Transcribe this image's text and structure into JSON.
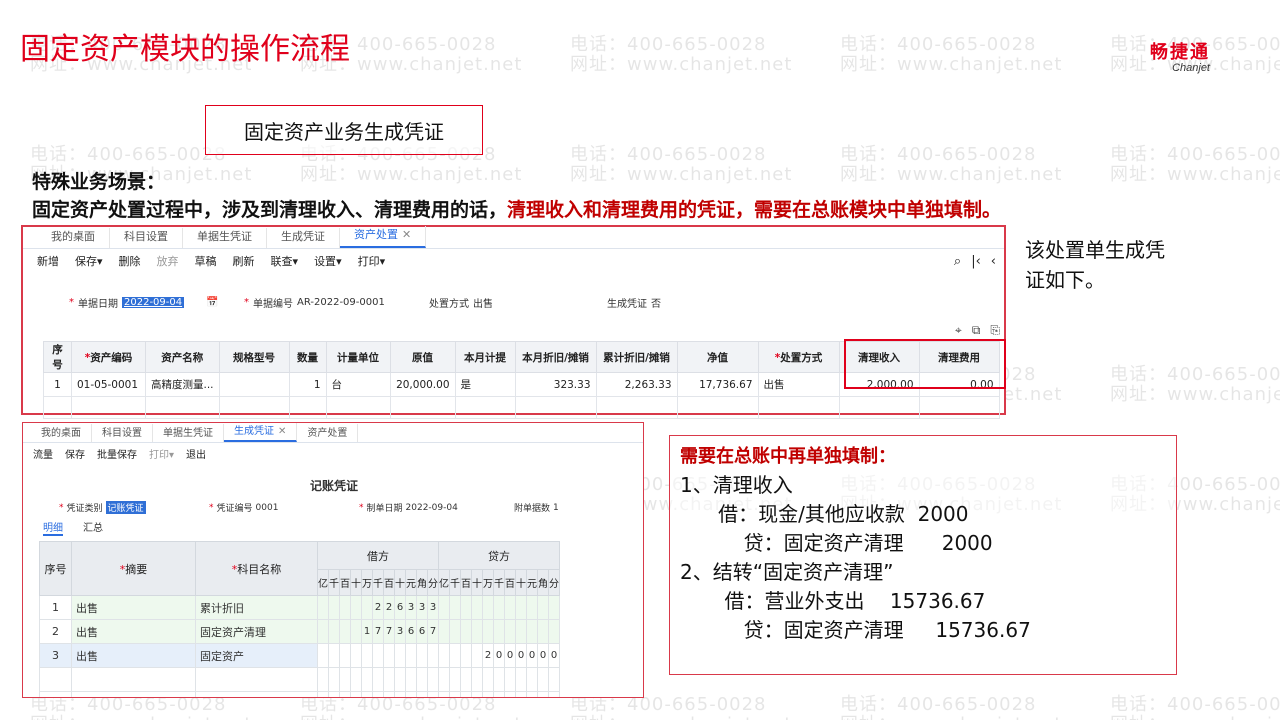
{
  "slide": {
    "title": "固定资产模块的操作流程",
    "subtitle": "固定资产业务生成凭证",
    "scenario_label": "特殊业务场景：",
    "scenario_text": "固定资产处置过程中，涉及到清理收入、清理费用的话，",
    "scenario_highlight": "清理收入和清理费用的凭证，需要在总账模块中单独填制。",
    "side_note": "该处置单生成凭证如下。",
    "logo_cn": "畅捷通",
    "logo_en": "Chanjet",
    "watermark_phone": "电话：400-665-0028",
    "watermark_web": "网址：www.chanjet.net"
  },
  "disposal_window": {
    "tabs": [
      {
        "label": "我的桌面"
      },
      {
        "label": "科目设置"
      },
      {
        "label": "单据生凭证"
      },
      {
        "label": "生成凭证"
      },
      {
        "label": "资产处置"
      }
    ],
    "toolbar": [
      "新增",
      "保存",
      "删除",
      "放弃",
      "草稿",
      "刷新",
      "联查",
      "设置",
      "打印"
    ],
    "toolbar_arrows": [
      "▾",
      "▾",
      "▾",
      "▾"
    ],
    "doc_date_label": "单据日期",
    "doc_date": "2022-09-04",
    "doc_no_label": "单据编号",
    "doc_no": "AR-2022-09-0001",
    "method_label": "处置方式",
    "method": "出售",
    "voucher_gen_label": "生成凭证",
    "voucher_gen": "否",
    "columns": [
      "序号",
      "资产编码",
      "资产名称",
      "规格型号",
      "数量",
      "计量单位",
      "原值",
      "本月计提",
      "本月折旧/摊销",
      "累计折旧/摊销",
      "净值",
      "处置方式",
      "清理收入",
      "清理费用"
    ],
    "rows": [
      [
        "1",
        "01-05-0001",
        "高精度测量...",
        "",
        "1",
        "台",
        "20,000.00",
        "是",
        "323.33",
        "2,263.33",
        "17,736.67",
        "出售",
        "2,000.00",
        "0.00"
      ]
    ]
  },
  "voucher_window": {
    "tabs": [
      {
        "label": "我的桌面"
      },
      {
        "label": "科目设置"
      },
      {
        "label": "单据生凭证"
      },
      {
        "label": "生成凭证"
      },
      {
        "label": "资产处置"
      }
    ],
    "toolbar": [
      "流量",
      "保存",
      "批量保存",
      "打印",
      "退出"
    ],
    "title": "记账凭证",
    "type_label": "凭证类别",
    "type": "记账凭证",
    "no_label": "凭证编号",
    "no": "0001",
    "date_label": "制单日期",
    "date": "2022-09-04",
    "attach_label": "附单据数",
    "attach": "1",
    "subtabs": [
      "明细",
      "汇总"
    ],
    "col_seq": "序号",
    "col_summary": "摘要",
    "col_account": "科目名称",
    "col_debit": "借方",
    "col_credit": "贷方",
    "digit_heads": [
      "亿",
      "千",
      "百",
      "十",
      "万",
      "千",
      "百",
      "十",
      "元",
      "角",
      "分"
    ],
    "rows": [
      {
        "seq": "1",
        "summary": "出售",
        "account": "累计折旧",
        "debit": "226333",
        "credit": ""
      },
      {
        "seq": "2",
        "summary": "出售",
        "account": "固定资产清理",
        "debit": "1773667",
        "credit": ""
      },
      {
        "seq": "3",
        "summary": "出售",
        "account": "固定资产",
        "debit": "",
        "credit": "2000000"
      }
    ]
  },
  "note": {
    "heading": "需要在总账中再单独填制：",
    "lines": [
      "1、清理收入",
      "      借：现金/其他应收款  2000",
      "          贷：固定资产清理      2000",
      "2、结转“固定资产清理”",
      "       借：营业外支出    15736.67",
      "          贷：固定资产清理     15736.67"
    ]
  },
  "colors": {
    "accent": "#e0001b",
    "highlight_text": "#c00000",
    "tab_active": "#2a6de0"
  }
}
